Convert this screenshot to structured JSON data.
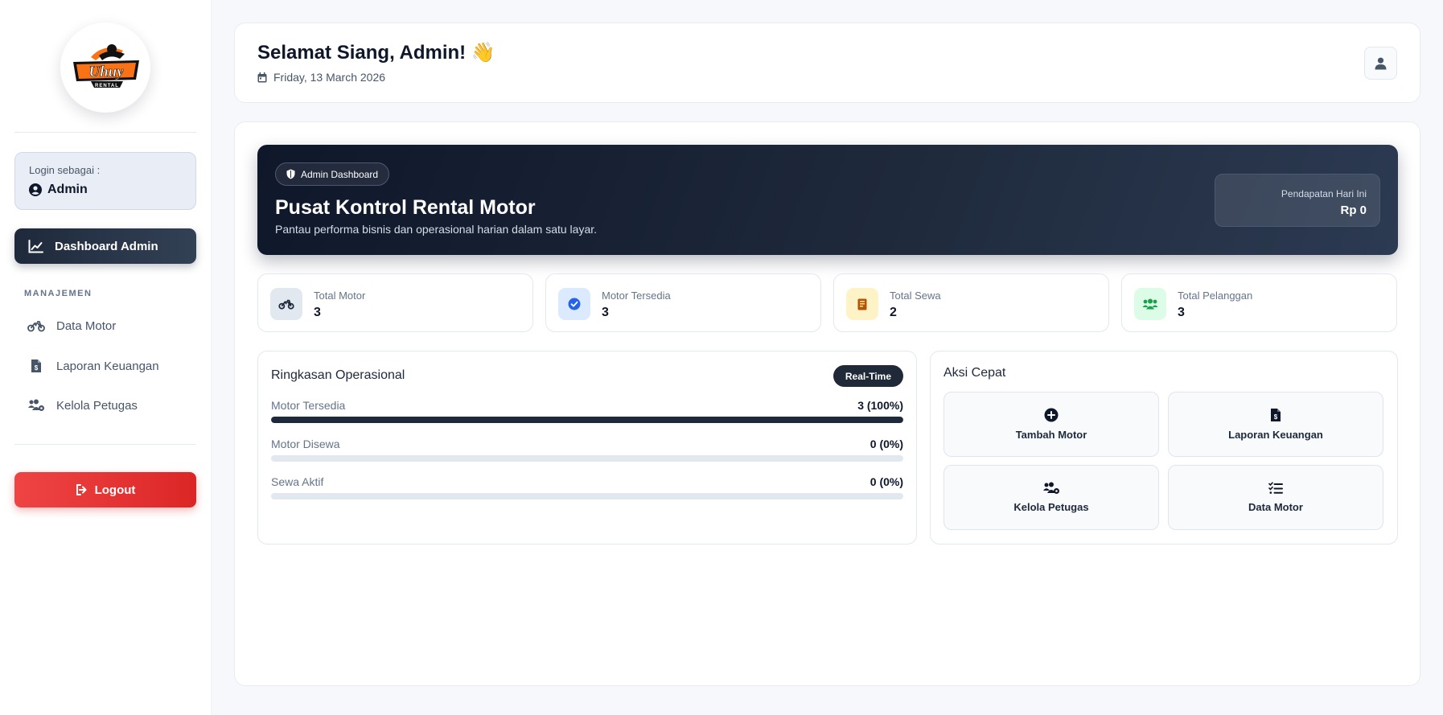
{
  "sidebar": {
    "logo": {
      "brand": "Uhuy",
      "sub": "RENTAL"
    },
    "login_label": "Login sebagai :",
    "login_user": "Admin",
    "nav_active": "Dashboard Admin",
    "section_label": "MANAJEMEN",
    "items": [
      {
        "label": "Data Motor",
        "icon": "motorcycle-icon"
      },
      {
        "label": "Laporan Keuangan",
        "icon": "invoice-icon"
      },
      {
        "label": "Kelola Petugas",
        "icon": "users-gear-icon"
      }
    ],
    "logout_label": "Logout"
  },
  "header": {
    "greeting": "Selamat Siang, Admin! 👋",
    "date": "Friday, 13 March 2026"
  },
  "hero": {
    "badge": "Admin Dashboard",
    "title": "Pusat Kontrol Rental Motor",
    "subtitle": "Pantau performa bisnis dan operasional harian dalam satu layar.",
    "revenue_label": "Pendapatan Hari Ini",
    "revenue_value": "Rp 0"
  },
  "stats": [
    {
      "label": "Total Motor",
      "value": "3",
      "icon": "motorcycle-icon",
      "bg": "#e2e8f0",
      "fg": "#1e293b"
    },
    {
      "label": "Motor Tersedia",
      "value": "3",
      "icon": "check-circle-icon",
      "bg": "#dbeafe",
      "fg": "#2563eb"
    },
    {
      "label": "Total Sewa",
      "value": "2",
      "icon": "book-icon",
      "bg": "#fef3c7",
      "fg": "#b45309"
    },
    {
      "label": "Total Pelanggan",
      "value": "3",
      "icon": "users-icon",
      "bg": "#dcfce7",
      "fg": "#16a34a"
    }
  ],
  "ops": {
    "title": "Ringkasan Operasional",
    "badge": "Real-Time",
    "rows": [
      {
        "label": "Motor Tersedia",
        "value": "3 (100%)",
        "percent": 100
      },
      {
        "label": "Motor Disewa",
        "value": "0 (0%)",
        "percent": 0
      },
      {
        "label": "Sewa Aktif",
        "value": "0 (0%)",
        "percent": 0
      }
    ]
  },
  "quick": {
    "title": "Aksi Cepat",
    "buttons": [
      {
        "label": "Tambah Motor",
        "icon": "plus-circle-icon"
      },
      {
        "label": "Laporan Keuangan",
        "icon": "invoice-icon"
      },
      {
        "label": "Kelola Petugas",
        "icon": "users-gear-icon"
      },
      {
        "label": "Data Motor",
        "icon": "list-check-icon"
      }
    ]
  },
  "colors": {
    "primary": "#1e293b",
    "danger": "#dc2626",
    "accent_logo": "#f97316"
  }
}
